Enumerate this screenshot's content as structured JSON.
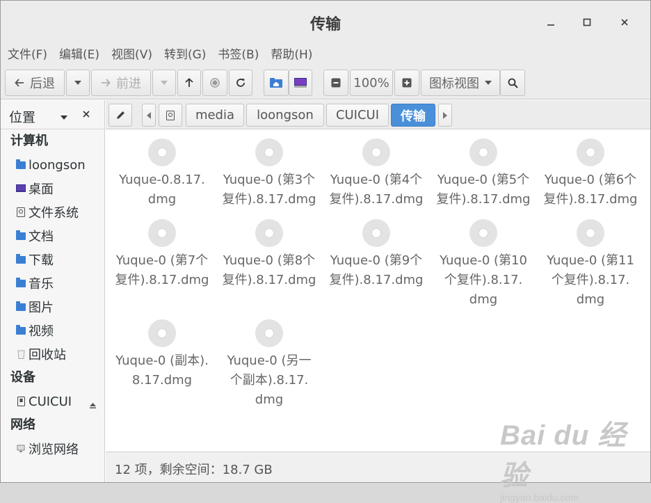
{
  "window": {
    "title": "传输"
  },
  "menubar": {
    "items": [
      "文件(F)",
      "编辑(E)",
      "视图(V)",
      "转到(G)",
      "书签(B)",
      "帮助(H)"
    ]
  },
  "toolbar": {
    "back_label": "后退",
    "forward_label": "前进",
    "zoom_level": "100%",
    "view_mode": "图标视图"
  },
  "sidebar": {
    "header": "位置",
    "categories": [
      {
        "label": "计算机",
        "items": [
          {
            "label": "loongson",
            "icon": "home-folder-icon"
          },
          {
            "label": "桌面",
            "icon": "desktop-icon"
          },
          {
            "label": "文件系统",
            "icon": "harddisk-icon"
          },
          {
            "label": "文档",
            "icon": "documents-folder-icon"
          },
          {
            "label": "下载",
            "icon": "download-folder-icon"
          },
          {
            "label": "音乐",
            "icon": "music-folder-icon"
          },
          {
            "label": "图片",
            "icon": "pictures-folder-icon"
          },
          {
            "label": "视频",
            "icon": "videos-folder-icon"
          },
          {
            "label": "回收站",
            "icon": "trash-icon"
          }
        ]
      },
      {
        "label": "设备",
        "items": [
          {
            "label": "CUICUI",
            "icon": "usb-drive-icon"
          }
        ]
      },
      {
        "label": "网络",
        "items": [
          {
            "label": "浏览网络",
            "icon": "network-icon"
          }
        ]
      }
    ]
  },
  "pathbar": {
    "crumbs": [
      "media",
      "loongson",
      "CUICUI",
      "传输"
    ],
    "active": "传输"
  },
  "files": [
    [
      "Yuque-0.8.17.",
      "dmg"
    ],
    [
      "Yuque-0 (第3个",
      "复件).8.17.dmg"
    ],
    [
      "Yuque-0 (第4个",
      "复件).8.17.dmg"
    ],
    [
      "Yuque-0 (第5个",
      "复件).8.17.dmg"
    ],
    [
      "Yuque-0 (第6个",
      "复件).8.17.dmg"
    ],
    [
      "Yuque-0 (第7个",
      "复件).8.17.dmg"
    ],
    [
      "Yuque-0 (第8个",
      "复件).8.17.dmg"
    ],
    [
      "Yuque-0 (第9个",
      "复件).8.17.dmg"
    ],
    [
      "Yuque-0 (第10",
      "个复件).8.17.",
      "dmg"
    ],
    [
      "Yuque-0 (第11",
      "个复件).8.17.",
      "dmg"
    ],
    [
      "Yuque-0 (副本).",
      "8.17.dmg"
    ],
    [
      "Yuque-0 (另一",
      "个副本).8.17.",
      "dmg"
    ]
  ],
  "statusbar": {
    "text": "12 项，剩余空间：18.7 GB"
  },
  "watermark": {
    "brand": "Bai du 经验",
    "url": "jingyan.baidu.com"
  },
  "colors": {
    "accent": "#4a90d9",
    "folder": "#3b7fd4"
  }
}
